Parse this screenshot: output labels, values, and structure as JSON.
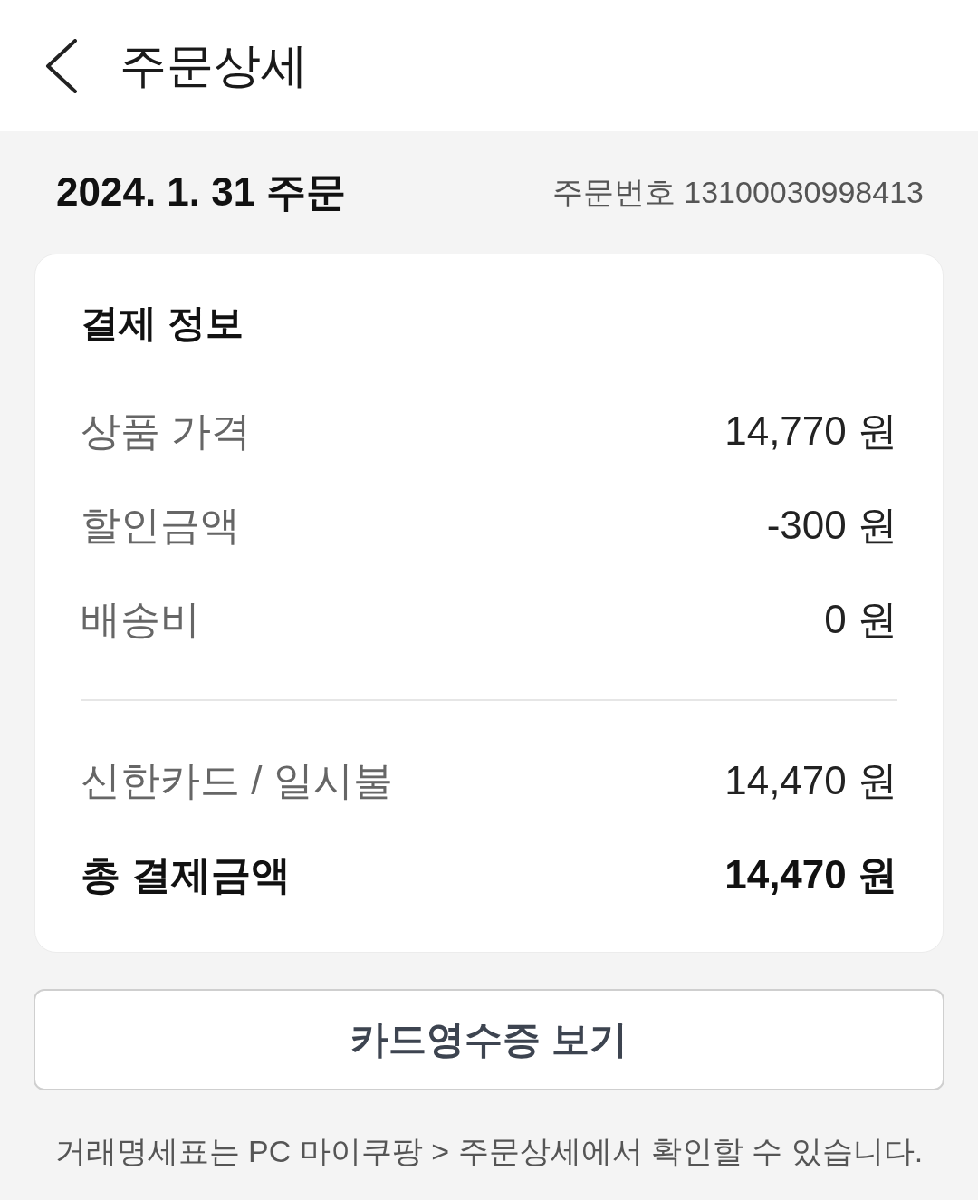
{
  "header": {
    "title": "주문상세"
  },
  "order": {
    "date": "2024. 1. 31 주문",
    "number": "주문번호 13100030998413"
  },
  "payment": {
    "title": "결제 정보",
    "breakdown": [
      {
        "label": "상품 가격",
        "value": "14,770 원"
      },
      {
        "label": "할인금액",
        "value": "-300 원"
      },
      {
        "label": "배송비",
        "value": "0 원"
      }
    ],
    "summary": [
      {
        "kind": "detail",
        "label": "신한카드 / 일시불",
        "value": "14,470 원"
      },
      {
        "kind": "total",
        "label": "총 결제금액",
        "value": "14,470 원"
      }
    ]
  },
  "receipt_button": {
    "label": "카드영수증 보기"
  },
  "footnote": "거래명세표는 PC 마이쿠팡 > 주문상세에서 확인할 수 있습니다."
}
